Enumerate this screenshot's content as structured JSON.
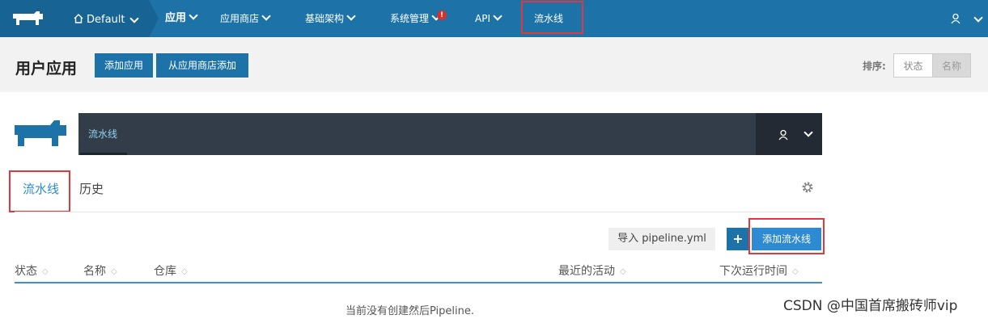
{
  "topnav": {
    "environment": "Default",
    "items": [
      {
        "label": "应用"
      },
      {
        "label": "应用商店"
      },
      {
        "label": "基础架构"
      },
      {
        "label": "系统管理",
        "alert": "!"
      },
      {
        "label": "API"
      },
      {
        "label": "流水线"
      }
    ]
  },
  "page": {
    "title": "用户应用",
    "add_app_button": "添加应用",
    "add_from_store_button": "从应用商店添加",
    "sort_label": "排序:",
    "sort_options": [
      "状态",
      "名称"
    ]
  },
  "pipeline": {
    "header_tab": "流水线",
    "tabs": [
      "流水线",
      "历史"
    ],
    "import_button": "导入 pipeline.yml",
    "plus_icon": "+",
    "add_button": "添加流水线",
    "columns": [
      "状态",
      "名称",
      "仓库",
      "最近的活动",
      "下次运行时间"
    ],
    "empty_message": "当前没有创建然后Pipeline."
  },
  "watermark": "CSDN @中国首席搬砖师vip",
  "colors": {
    "nav_bg": "#1d73a8",
    "nav_dark": "#176393",
    "highlight": "#e0383e",
    "pipeline_header": "#333d4a",
    "accent": "#2e8bd3"
  }
}
